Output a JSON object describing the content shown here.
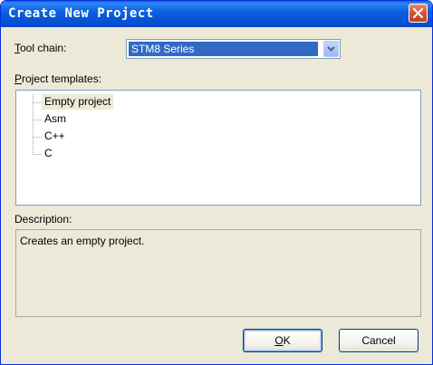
{
  "window": {
    "title": "Create New Project",
    "close_icon": "close-icon"
  },
  "toolchain": {
    "label_accel": "T",
    "label_rest": "ool chain:",
    "value": "STM8 Series",
    "dropdown_icon": "chevron-down-icon"
  },
  "templates": {
    "label_accel": "P",
    "label_rest": "roject templates:",
    "items": [
      {
        "label": "Empty project",
        "selected": true
      },
      {
        "label": "Asm",
        "selected": false
      },
      {
        "label": "C++",
        "selected": false
      },
      {
        "label": "C",
        "selected": false
      }
    ]
  },
  "description": {
    "label": "Description:",
    "text": "Creates an empty project."
  },
  "buttons": {
    "ok_accel": "O",
    "ok_rest": "K",
    "cancel": "Cancel"
  },
  "colors": {
    "titlebar": "#0a5fe8",
    "dialog_bg": "#ece9d8",
    "selection": "#316ac5",
    "close_button": "#d9512f"
  }
}
